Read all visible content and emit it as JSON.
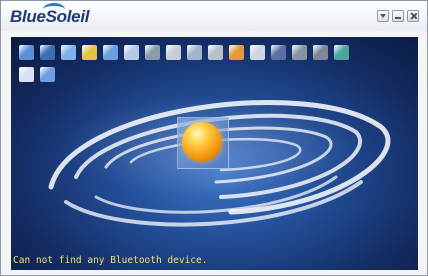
{
  "app": {
    "title": "BlueSoleil"
  },
  "window_controls": [
    {
      "name": "menu-button",
      "icon": "dropdown-icon"
    },
    {
      "name": "minimize-button",
      "icon": "minimize-icon"
    },
    {
      "name": "close-button",
      "icon": "close-icon"
    }
  ],
  "toolbar": {
    "row1": [
      {
        "id": "computer",
        "icon": "computer-icon",
        "color": "#5b8fd6"
      },
      {
        "id": "network",
        "icon": "network-access-icon",
        "color": "#3a6fb5"
      },
      {
        "id": "dialup",
        "icon": "dialup-icon",
        "color": "#7fb0e8"
      },
      {
        "id": "file-transfer",
        "icon": "file-transfer-icon",
        "color": "#e8c34a"
      },
      {
        "id": "lan",
        "icon": "lan-icon",
        "color": "#6aa0e0"
      },
      {
        "id": "business-card",
        "icon": "business-card-icon",
        "color": "#b8c9e6"
      },
      {
        "id": "keyboard",
        "icon": "keyboard-icon",
        "color": "#8a9bb0"
      },
      {
        "id": "mouse",
        "icon": "mouse-icon",
        "color": "#c6ced8"
      },
      {
        "id": "sync",
        "icon": "sync-icon",
        "color": "#9fb4d0"
      },
      {
        "id": "fax",
        "icon": "fax-icon",
        "color": "#b7c0cc"
      },
      {
        "id": "image",
        "icon": "image-icon",
        "color": "#e49a3c"
      },
      {
        "id": "headset",
        "icon": "headset-icon",
        "color": "#cdd6e2"
      },
      {
        "id": "audio",
        "icon": "audio-gateway-icon",
        "color": "#5870a8"
      },
      {
        "id": "folder-share",
        "icon": "folder-share-icon",
        "color": "#8893a3"
      },
      {
        "id": "pan",
        "icon": "personal-area-network-icon",
        "color": "#7d8797"
      },
      {
        "id": "globe",
        "icon": "globe-icon",
        "color": "#4fa3a0"
      }
    ],
    "row2": [
      {
        "id": "user",
        "icon": "user-icon",
        "color": "#d9e2ee"
      },
      {
        "id": "printer",
        "icon": "printer-icon",
        "color": "#6d9fe0"
      }
    ]
  },
  "status_text": "Can not find any Bluetooth device."
}
